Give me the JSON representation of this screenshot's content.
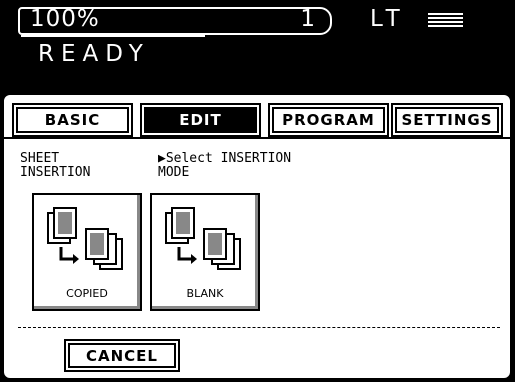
{
  "status": {
    "zoom": "100%",
    "copies": "1",
    "paper_size": "LT",
    "paper_icon": "paper-tray-icon",
    "message": "READY"
  },
  "tabs": [
    {
      "label": "BASIC",
      "active": false
    },
    {
      "label": "EDIT",
      "active": true
    },
    {
      "label": "PROGRAM",
      "active": false
    },
    {
      "label": "SETTINGS",
      "active": false
    }
  ],
  "screen": {
    "title": "SHEET\nINSERTION",
    "instruction": "▶Select INSERTION\nMODE"
  },
  "modes": [
    {
      "label": "COPIED",
      "icon": "copied-insertion-icon"
    },
    {
      "label": "BLANK",
      "icon": "blank-insertion-icon"
    }
  ],
  "cancel_label": "CANCEL"
}
